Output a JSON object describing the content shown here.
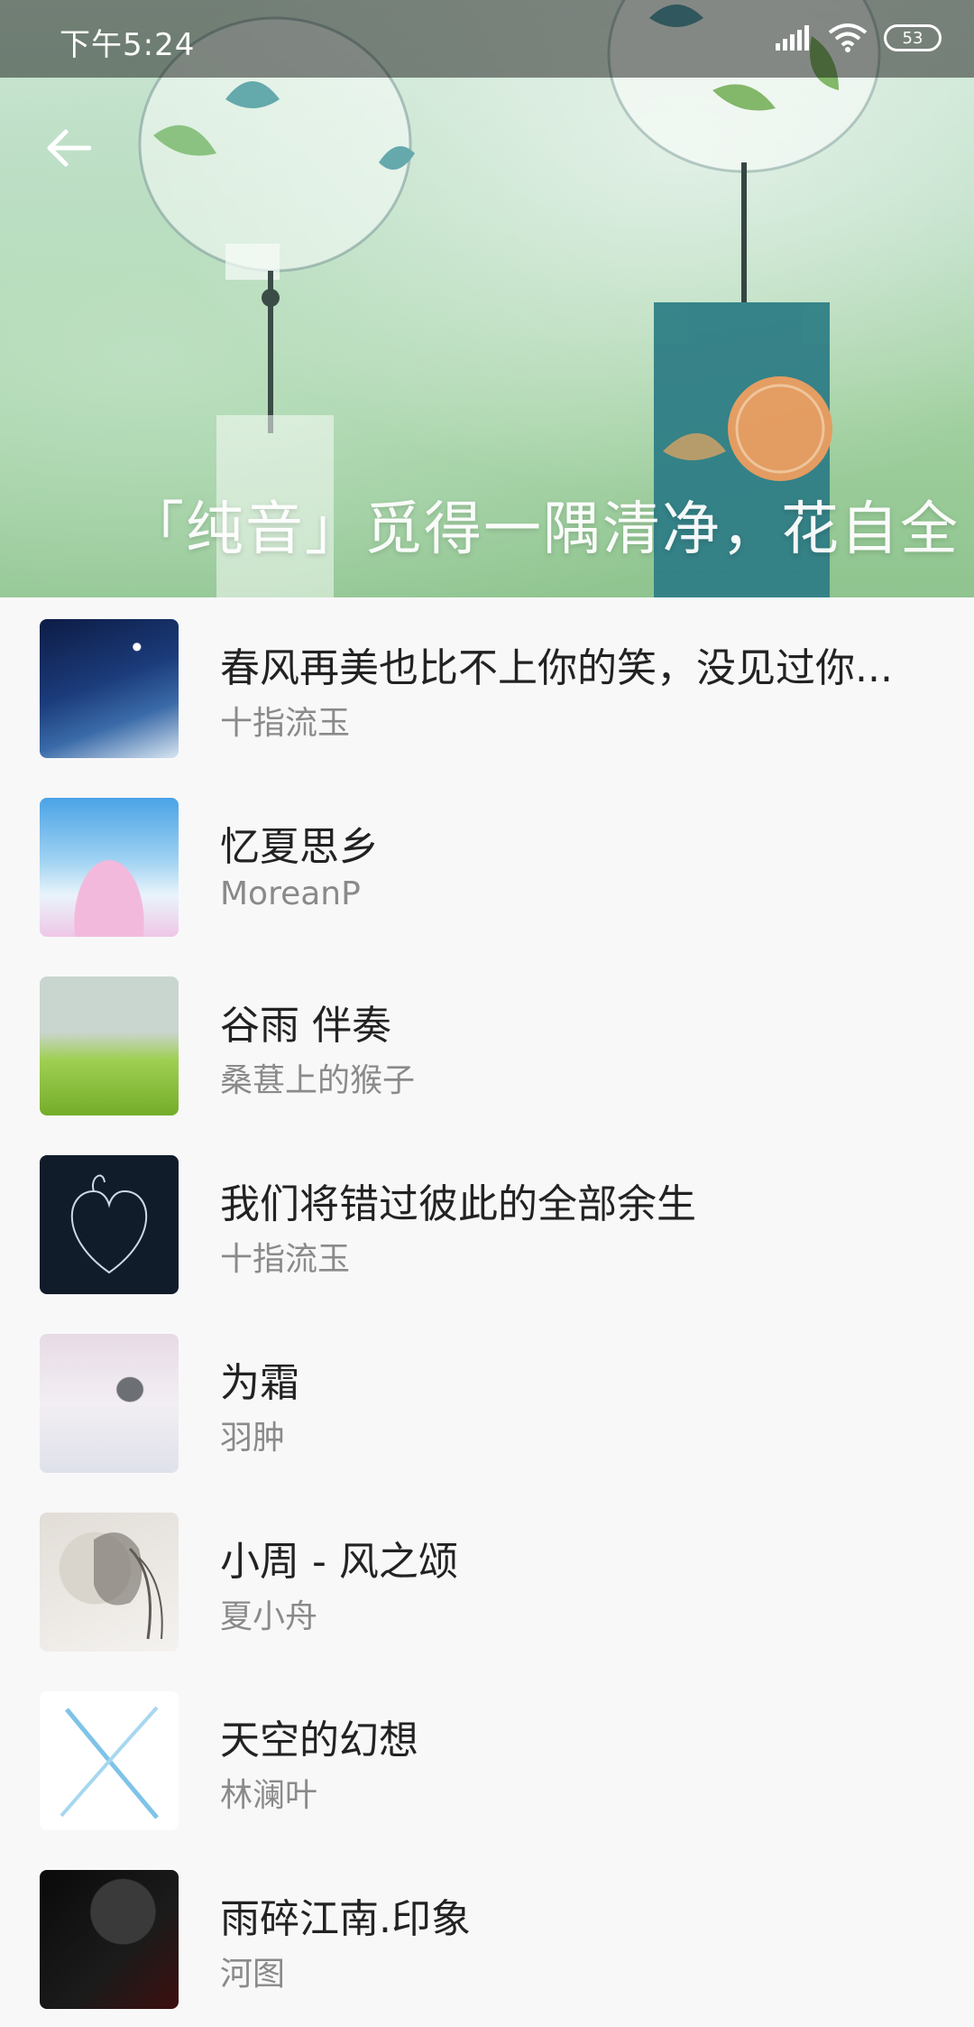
{
  "status_bar": {
    "time": "下午5:24",
    "battery": "53"
  },
  "header": {
    "title": "「纯音」觅得一隅清净，花自全"
  },
  "songs": [
    {
      "title": "春风再美也比不上你的笑，没见过你...",
      "artist": "十指流玉"
    },
    {
      "title": "忆夏思乡",
      "artist": "MoreanP"
    },
    {
      "title": "谷雨 伴奏",
      "artist": "桑葚上的猴子"
    },
    {
      "title": "我们将错过彼此的全部余生",
      "artist": "十指流玉"
    },
    {
      "title": "为霜",
      "artist": "羽肿"
    },
    {
      "title": "小周 - 风之颂",
      "artist": "夏小舟"
    },
    {
      "title": "天空的幻想",
      "artist": "林澜叶"
    },
    {
      "title": "雨碎江南.印象",
      "artist": "河图"
    }
  ]
}
